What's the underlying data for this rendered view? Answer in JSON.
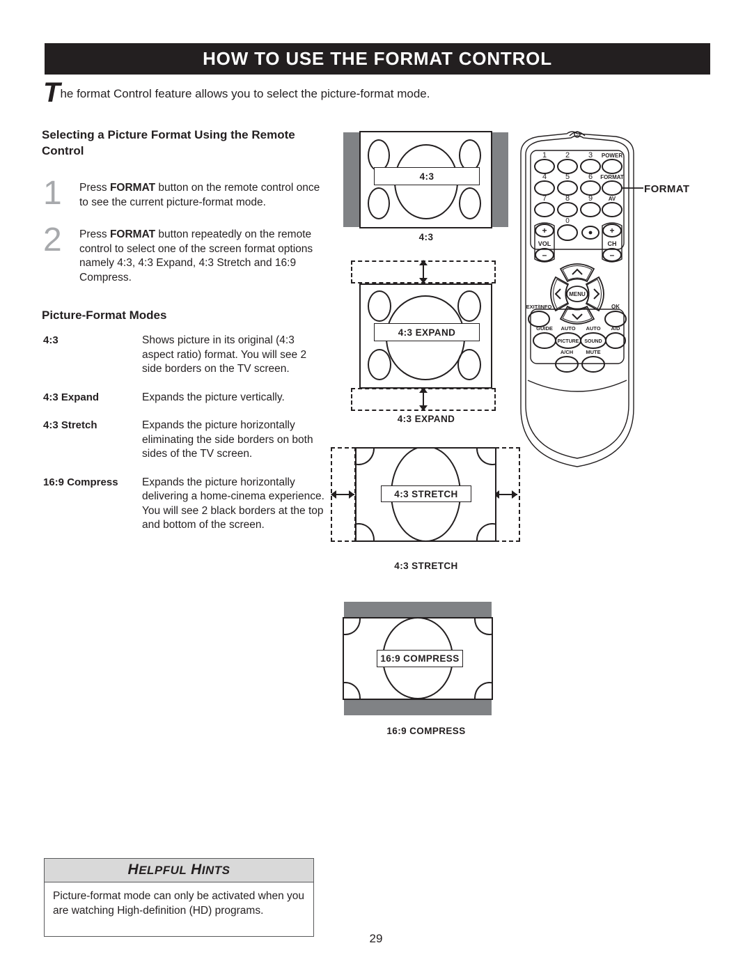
{
  "header": {
    "title": "HOW TO USE THE FORMAT CONTROL"
  },
  "intro": {
    "dropcap": "T",
    "text": "he format Control feature allows you to select the picture-format mode."
  },
  "sections": {
    "selecting_heading": "Selecting a Picture Format Using the Remote Control",
    "modes_heading": "Picture-Format Modes"
  },
  "steps": [
    {
      "number": "1",
      "pre": "Press ",
      "bold": "FORMAT",
      "post": " button on the remote control once to see the current picture-format mode."
    },
    {
      "number": "2",
      "pre": "Press ",
      "bold": "FORMAT",
      "post": " button repeatedly on the remote control to select one of the screen format options namely 4:3, 4:3 Expand, 4:3 Stretch and 16:9 Compress."
    }
  ],
  "modes": [
    {
      "term": "4:3",
      "desc": "Shows picture in its original (4:3 aspect ratio) format. You will see 2 side borders on the TV screen."
    },
    {
      "term": "4:3 Expand",
      "desc": "Expands the picture vertically."
    },
    {
      "term": "4:3 Stretch",
      "desc": "Expands the picture horizontally eliminating the side borders on both sides of the TV screen."
    },
    {
      "term": "16:9 Compress",
      "desc": "Expands the picture horizontally delivering a home-cinema experience. You will see 2 black borders at the top and bottom of the screen."
    }
  ],
  "diagrams": [
    {
      "label": "4:3",
      "caption": "4:3"
    },
    {
      "label": "4:3 EXPAND",
      "caption": "4:3 EXPAND"
    },
    {
      "label": "4:3 STRETCH",
      "caption": "4:3 STRETCH"
    },
    {
      "label": "16:9 COMPRESS",
      "caption": "16:9 COMPRESS"
    }
  ],
  "remote": {
    "callout": "FORMAT",
    "keypad": [
      {
        "label": "1"
      },
      {
        "label": "2"
      },
      {
        "label": "3"
      },
      {
        "label": "POWER"
      },
      {
        "label": "4"
      },
      {
        "label": "5"
      },
      {
        "label": "6"
      },
      {
        "label": "FORMAT"
      },
      {
        "label": "7"
      },
      {
        "label": "8"
      },
      {
        "label": "9"
      },
      {
        "label": "AV"
      }
    ],
    "vol_label": "VOL",
    "ch_label": "CH",
    "vol_plus": "+",
    "vol_minus": "–",
    "ch_plus": "+",
    "ch_minus": "–",
    "zero": "0",
    "dot": "·",
    "menu": "MENU",
    "exit_info": "EXIT/INFO",
    "ok": "OK",
    "bottom_row": [
      {
        "label": "GUIDE"
      },
      {
        "label": "AUTO",
        "sub": "PICTURE"
      },
      {
        "label": "AUTO",
        "sub": "SOUND"
      },
      {
        "label": "A/D"
      }
    ],
    "bottom_row2": [
      {
        "label": "A/CH"
      },
      {
        "label": "MUTE"
      }
    ]
  },
  "hints": {
    "heading": "Helpful Hints",
    "body": "Picture-format mode can only be activated when you are watching High-definition (HD) programs."
  },
  "page_number": "29",
  "colors": {
    "header_bg": "#231f20",
    "gray_bar": "#808285",
    "step_number": "#a7a9ac",
    "hints_head_bg": "#d9d9d9"
  }
}
